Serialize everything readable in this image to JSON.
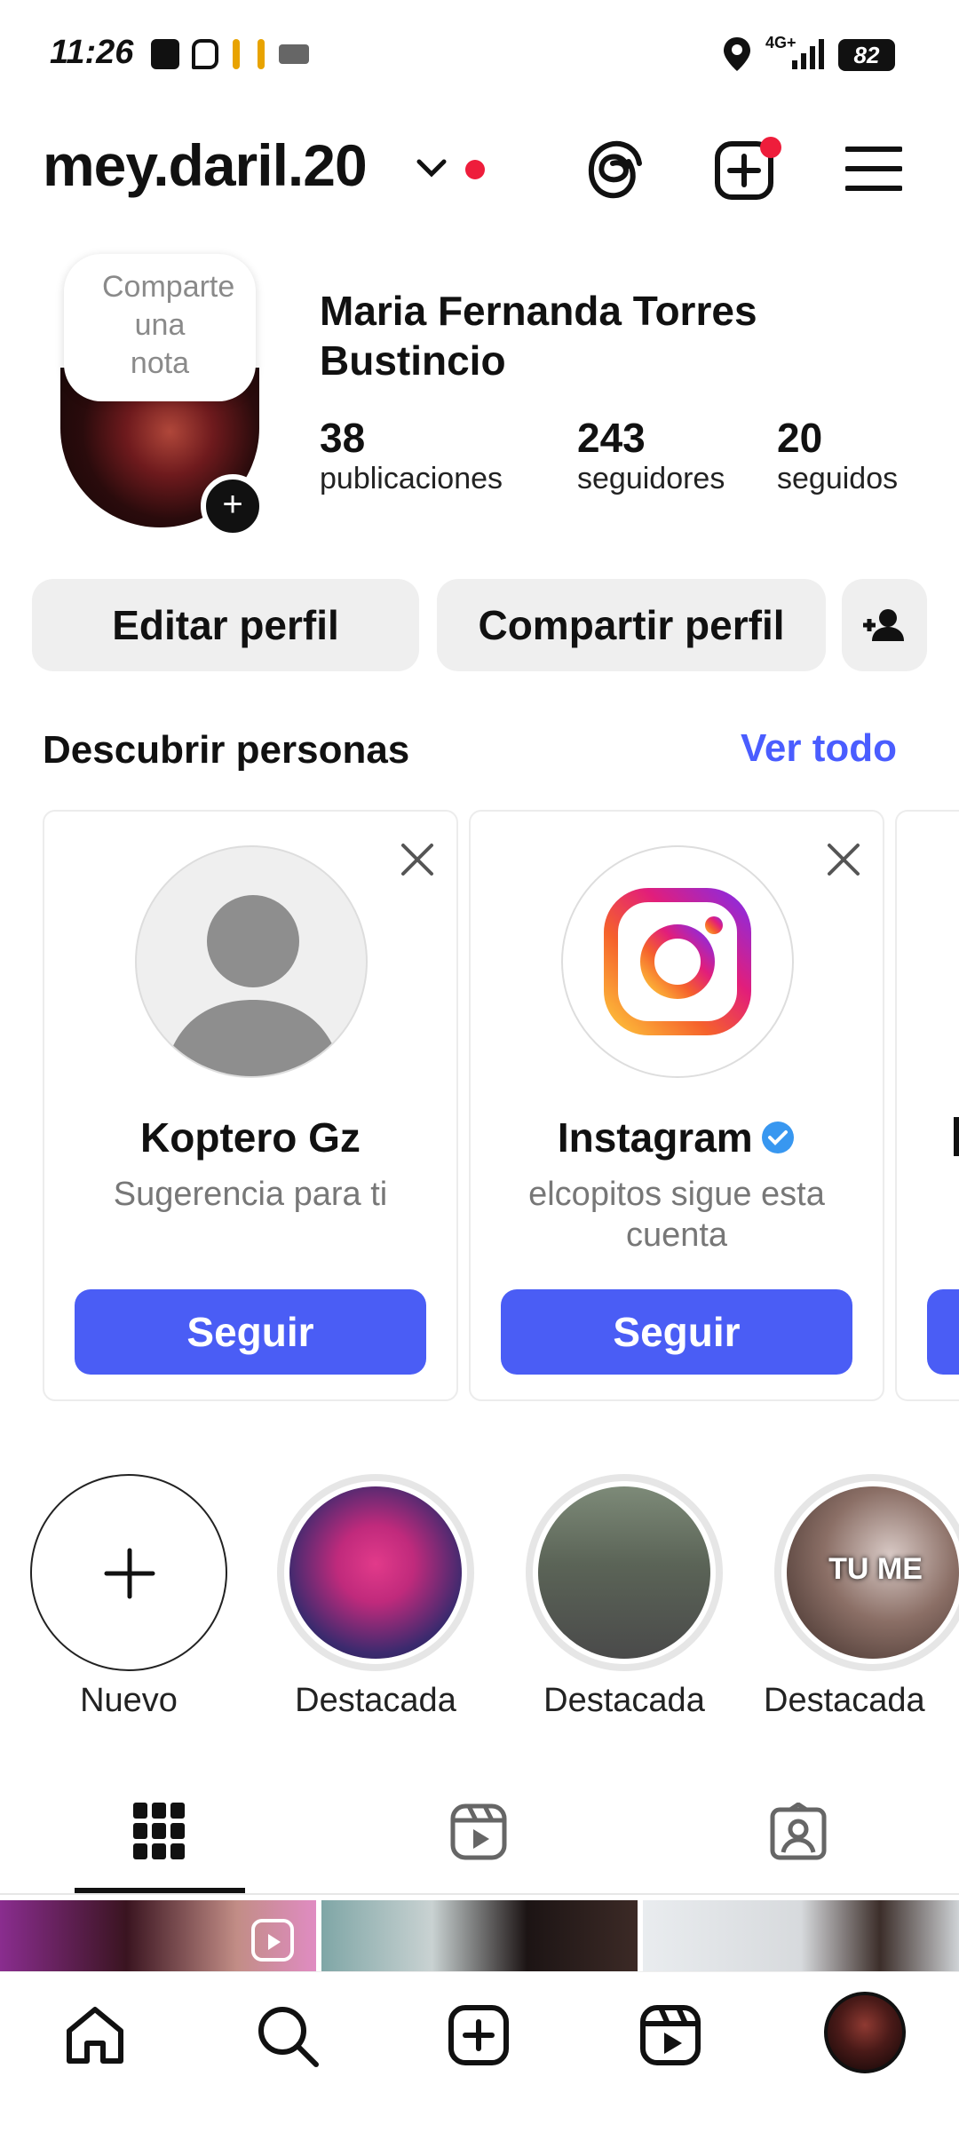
{
  "status_bar": {
    "time": "11:26",
    "network": "4G+",
    "battery": "82"
  },
  "header": {
    "username": "mey.daril.20",
    "icons": [
      "chevron-down-icon",
      "threads-icon",
      "new-post-icon",
      "menu-icon"
    ]
  },
  "profile": {
    "note": "Comparte una nota",
    "full_name": "Maria Fernanda Torres Bustincio",
    "stats": [
      {
        "value": "38",
        "label": "publicaciones"
      },
      {
        "value": "243",
        "label": "seguidores"
      },
      {
        "value": "20",
        "label": "seguidos"
      }
    ]
  },
  "actions": {
    "edit": "Editar perfil",
    "share": "Compartir perfil"
  },
  "discover": {
    "title": "Descubrir personas",
    "see_all": "Ver todo",
    "cards": [
      {
        "name": "Koptero Gz",
        "subtitle": "Sugerencia para ti",
        "button": "Seguir"
      },
      {
        "name": "Instagram",
        "subtitle": "elcopitos sigue esta cuenta",
        "button": "Seguir"
      }
    ]
  },
  "highlights": [
    {
      "label": "Nuevo"
    },
    {
      "label": "Destacada"
    },
    {
      "label": "Destacada"
    },
    {
      "label": "Destacada",
      "overlay": "TU ME"
    }
  ],
  "tabs": [
    "grid-icon",
    "reels-icon",
    "tagged-icon"
  ],
  "nav": [
    "home-icon",
    "search-icon",
    "create-icon",
    "reels-icon",
    "profile-avatar"
  ],
  "colors": {
    "accent": "#4a5df5",
    "notification": "#ee1d3b"
  }
}
